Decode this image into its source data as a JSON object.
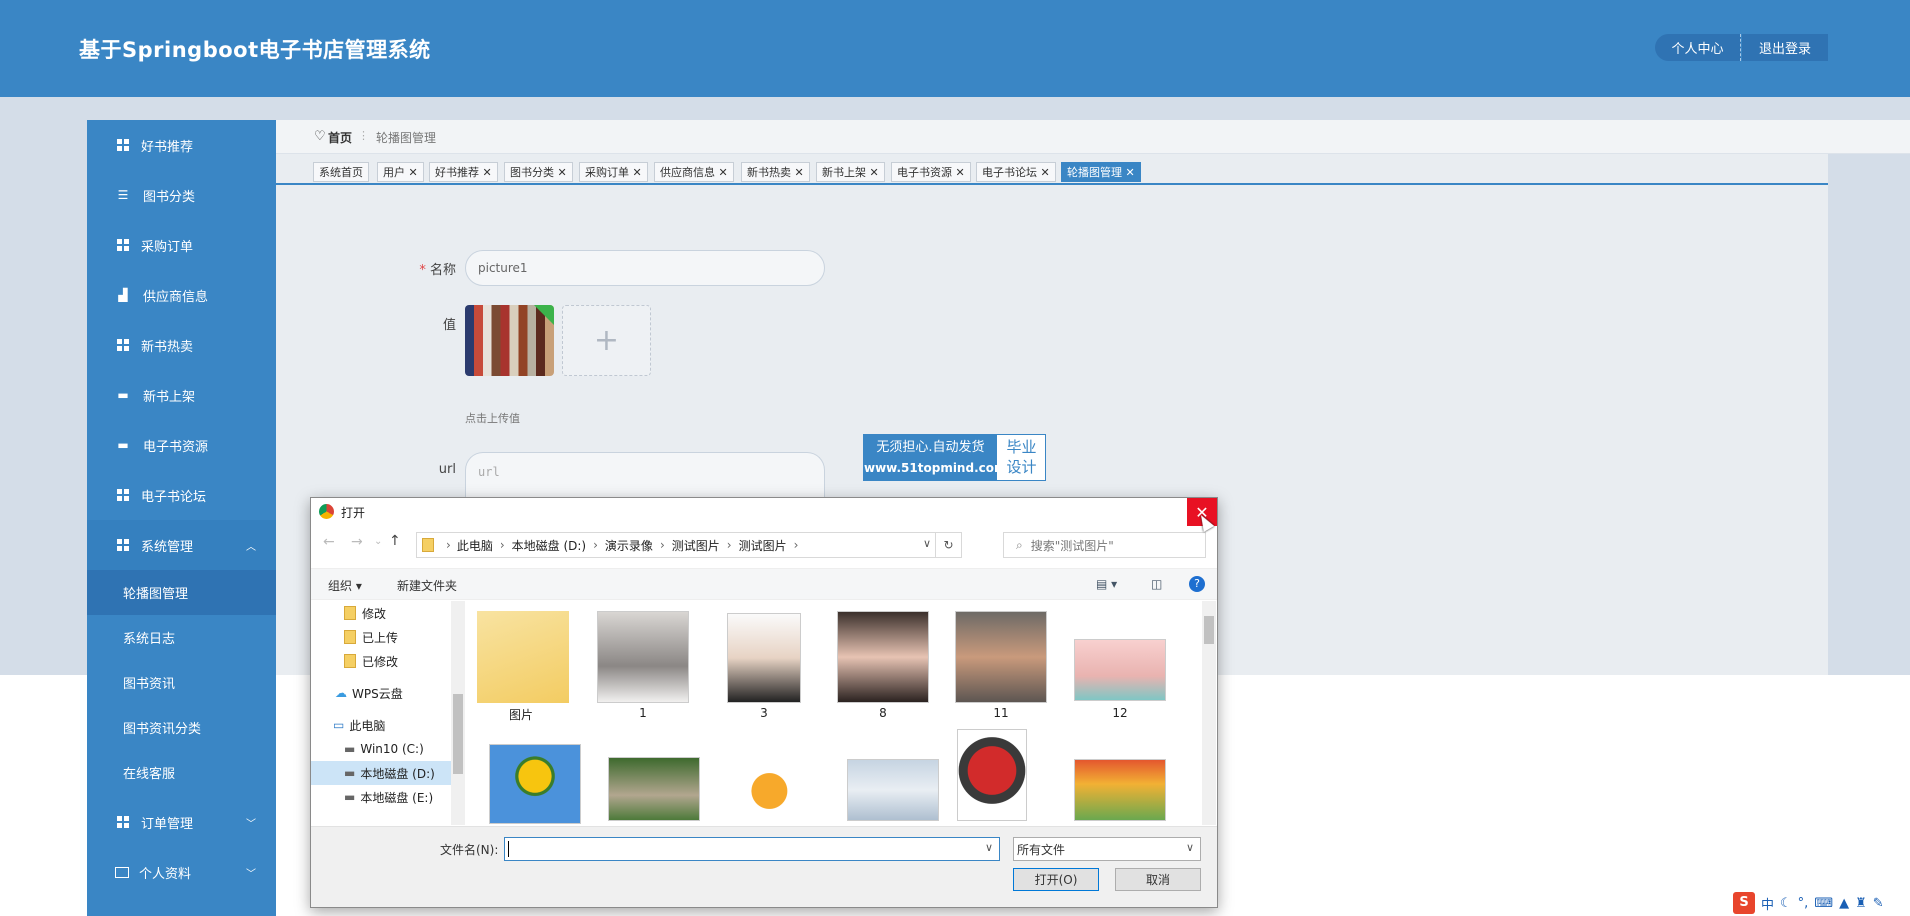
{
  "header": {
    "title": "基于Springboot电子书店管理系统",
    "profile_btn": "个人中心",
    "logout_btn": "退出登录"
  },
  "sidebar": {
    "items": [
      {
        "label": "好书推荐",
        "icon": "grid-icon"
      },
      {
        "label": "图书分类",
        "icon": "sliders-icon"
      },
      {
        "label": "采购订单",
        "icon": "grid-icon"
      },
      {
        "label": "供应商信息",
        "icon": "thumbs-up-icon"
      },
      {
        "label": "新书热卖",
        "icon": "grid-icon"
      },
      {
        "label": "新书上架",
        "icon": "monitor-icon"
      },
      {
        "label": "电子书资源",
        "icon": "monitor-icon"
      },
      {
        "label": "电子书论坛",
        "icon": "grid-icon"
      },
      {
        "label": "系统管理",
        "icon": "grid-icon"
      }
    ],
    "sub_items": [
      "轮播图管理",
      "系统日志",
      "图书资讯",
      "图书资讯分类",
      "在线客服"
    ],
    "bottom_items": [
      {
        "label": "订单管理",
        "icon": "grid-icon"
      },
      {
        "label": "个人资料",
        "icon": "card-icon"
      }
    ]
  },
  "breadcrumb": {
    "home": "首页",
    "current": "轮播图管理"
  },
  "tabs": [
    "系统首页",
    "用户",
    "好书推荐",
    "图书分类",
    "采购订单",
    "供应商信息",
    "新书热卖",
    "新书上架",
    "电子书资源",
    "电子书论坛",
    "轮播图管理"
  ],
  "form": {
    "name_label": "名称",
    "name_required": "*",
    "name_value": "picture1",
    "value_label": "值",
    "upload_hint": "点击上传值",
    "url_label": "url",
    "url_placeholder": "url",
    "plus": "+"
  },
  "watermark": {
    "line1": "无须担心.自动发货",
    "line2": "www.51topmind.com",
    "side1": "毕业",
    "side2": "设计"
  },
  "dialog": {
    "title": "打开",
    "path": [
      "此电脑",
      "本地磁盘 (D:)",
      "演示录像",
      "测试图片",
      "测试图片"
    ],
    "search_placeholder": "搜索\"测试图片\"",
    "organize": "组织 ▾",
    "new_folder": "新建文件夹",
    "tree": [
      "修改",
      "已上传",
      "已修改",
      "WPS云盘",
      "此电脑",
      "Win10 (C:)",
      "本地磁盘 (D:)",
      "本地磁盘 (E:)"
    ],
    "files": [
      "图片",
      "1",
      "3",
      "8",
      "11",
      "12"
    ],
    "filename_label": "文件名(N):",
    "filename_value": "",
    "filetype": "所有文件",
    "open_btn": "打开(O)",
    "cancel_btn": "取消"
  },
  "tray": {
    "ime": "中"
  }
}
